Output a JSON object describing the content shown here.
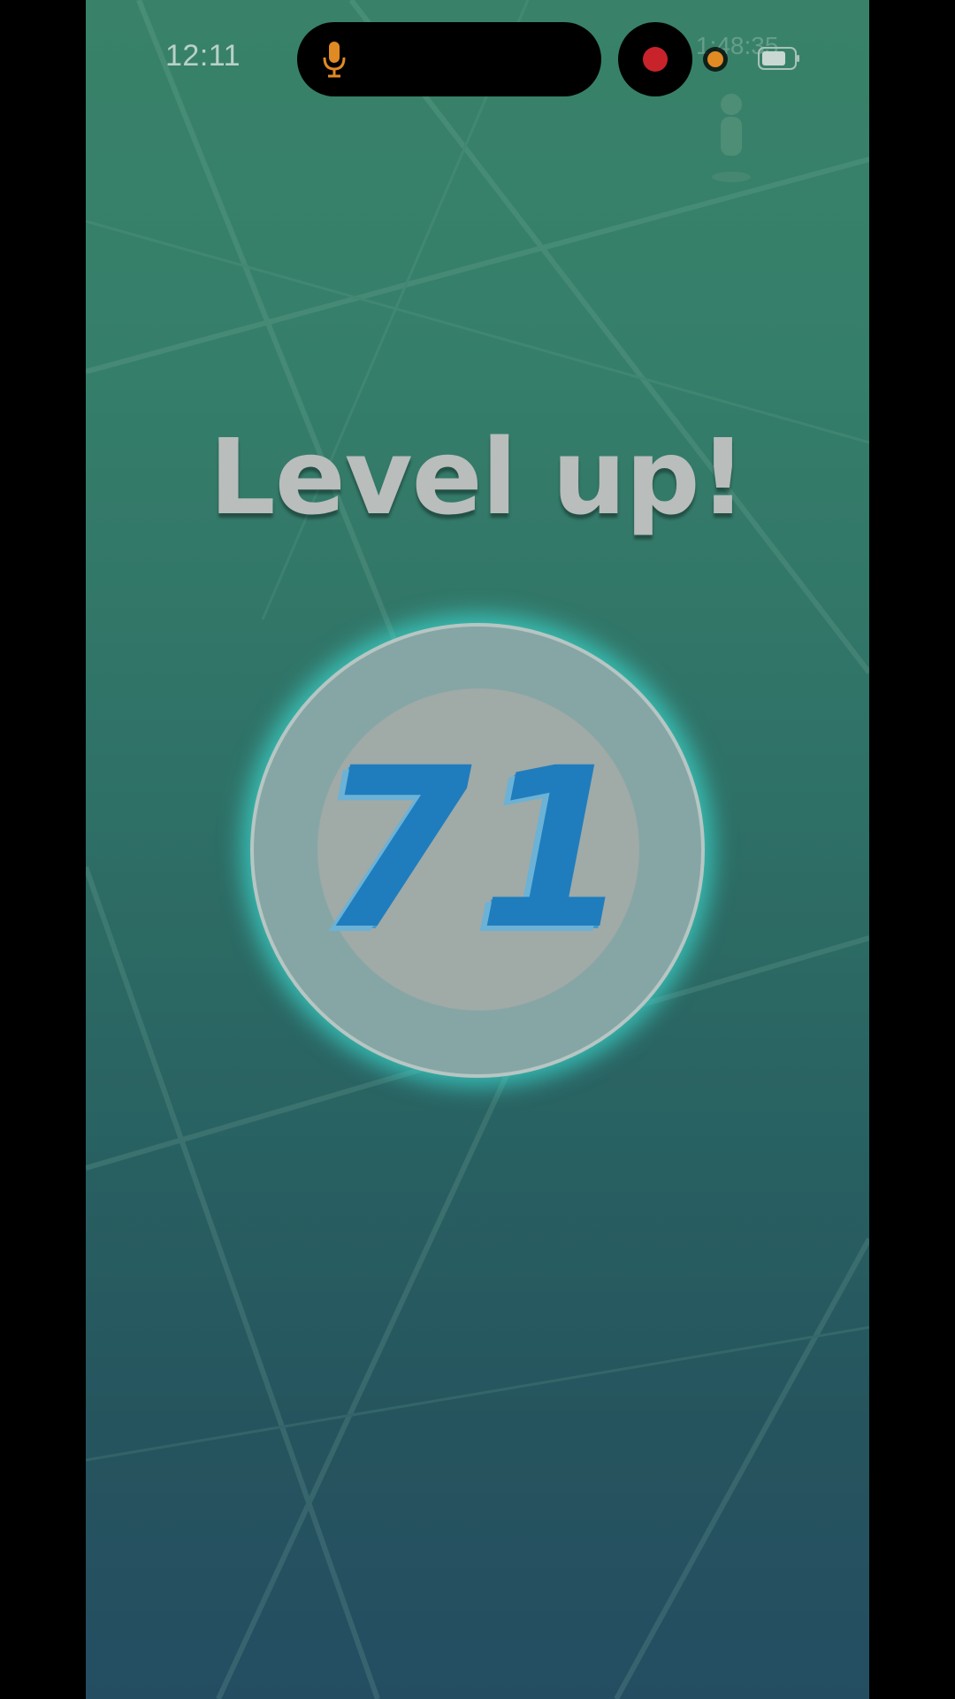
{
  "status_bar": {
    "time": "12:11",
    "recording_timer": "1:48:35"
  },
  "level_up": {
    "title": "Level up!",
    "level": "71"
  },
  "colors": {
    "glow": "#40e0d0",
    "level_number": "#1f7dbd",
    "record_dot": "#c8232b",
    "mic_icon": "#e08a24"
  },
  "icons": [
    "microphone-icon",
    "record-icon",
    "privacy-indicator-dot",
    "battery-icon"
  ]
}
